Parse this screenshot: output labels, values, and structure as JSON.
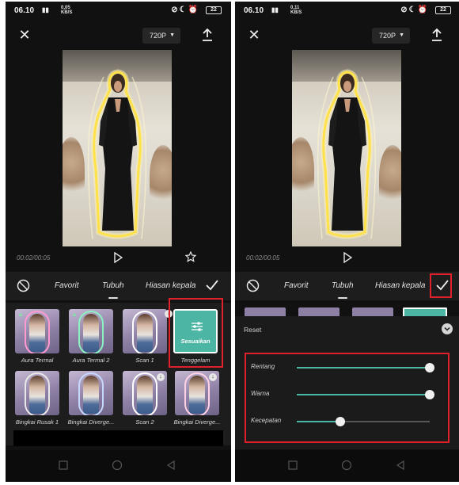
{
  "left_screen": {
    "status": {
      "time": "06.10",
      "net": "0,05",
      "net_unit": "KB/S",
      "battery": "22"
    },
    "toolbar": {
      "resolution": "720P"
    },
    "player": {
      "timecode": "00:02/00:05"
    },
    "tabs": [
      {
        "label": "Favorit"
      },
      {
        "label": "Tubuh"
      },
      {
        "label": "Hiasan kepala"
      }
    ],
    "effects_row1": [
      {
        "label": "Aura Termal"
      },
      {
        "label": "Aura Termal 2"
      },
      {
        "label": "Scan 1"
      }
    ],
    "adjust_tile": {
      "text": "Sesuaikan",
      "label": "Tenggelam"
    },
    "effects_row2": [
      {
        "label": "Bingkai Rusak 1"
      },
      {
        "label": "Bingkai Diverge..."
      },
      {
        "label": "Scan 2"
      },
      {
        "label": "Bingkai Diverge..."
      }
    ]
  },
  "right_screen": {
    "status": {
      "time": "06.10",
      "net": "0,11",
      "net_unit": "KB/S",
      "battery": "22"
    },
    "toolbar": {
      "resolution": "720P"
    },
    "player": {
      "timecode": "00:02/00:05"
    },
    "tabs": [
      {
        "label": "Favorit"
      },
      {
        "label": "Tubuh"
      },
      {
        "label": "Hiasan kepala"
      }
    ],
    "panel": {
      "reset_label": "Reset",
      "sliders": [
        {
          "label": "Rentang",
          "value": 1.0
        },
        {
          "label": "Warna",
          "value": 1.0
        },
        {
          "label": "Kecepatan",
          "value": 0.33
        }
      ]
    }
  },
  "colors": {
    "accent": "#4ab8a6",
    "highlight_box": "#e0202a",
    "glow": "#ffe14a"
  }
}
